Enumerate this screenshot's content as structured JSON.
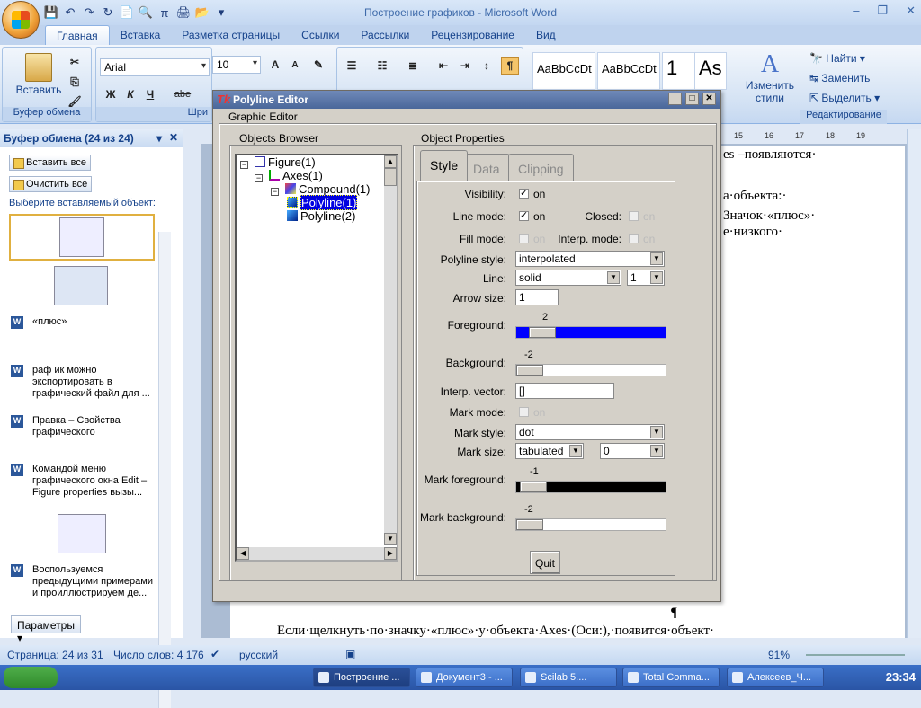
{
  "word": {
    "title": "Построение графиков - Microsoft Word",
    "qat": [
      "💾",
      "↶",
      "↷",
      "↻",
      "📄",
      "🔍",
      "π",
      "🖨",
      "📂",
      "▾"
    ],
    "controls": [
      "–",
      "❐",
      "✕"
    ],
    "tabs": [
      "Главная",
      "Вставка",
      "Разметка страницы",
      "Ссылки",
      "Рассылки",
      "Рецензирование",
      "Вид"
    ],
    "ribbon": {
      "paste_label": "Вставить",
      "clipboard_group": "Буфер обмена",
      "font_group_partial": "Шри",
      "font_name": "Arial",
      "font_size": "10",
      "bold": "Ж",
      "italic": "К",
      "underline": "Ч",
      "strike": "abe",
      "styles": [
        "AaBbCcDt",
        "AaBbCcDt",
        "1",
        "As"
      ],
      "change_styles": "Изменить стили",
      "find": "Найти",
      "replace": "Заменить",
      "select": "Выделить",
      "editing_group": "Редактирование"
    }
  },
  "clipboard": {
    "header": "Буфер обмена (24 из 24)",
    "paste_all": "Вставить все",
    "clear_all": "Очистить все",
    "prompt": "Выберите вставляемый объект:",
    "items": [
      "«плюс»",
      "раф ик можно экспортировать в графический файл для ...",
      "Правка – Свойства графического",
      "Командой меню графического окна Edit – Figure properties вызы...",
      "Воспользуемся предыдущими примерами и проиллюстрируем де..."
    ],
    "params": "Параметры"
  },
  "document": {
    "ruler_marks": [
      "15",
      "16",
      "17",
      "18",
      "19"
    ],
    "line1": "es –появляются·",
    "line2": "а·объекта:·",
    "line3": "Значок·«плюс»·",
    "line4": "е·низкого·",
    "bottom_line": "Если·щелкнуть·по·значку·«плюс»·у·объекта·Axes·(Оси:),·появится·объект·",
    "para_mark": "¶"
  },
  "status": {
    "page": "Страница: 24 из 31",
    "words": "Число слов: 4 176",
    "lang": "русский",
    "zoom": "91%"
  },
  "taskbar": {
    "tasks": [
      "Построение ...",
      "Документ3 - ...",
      "Scilab 5....",
      "Total Comma...",
      "Алексеев_Ч..."
    ],
    "clock": "23:34"
  },
  "editor": {
    "title": "Polyline Editor",
    "tk_icon": "Tk",
    "graphic_editor": "Graphic Editor",
    "objects_browser": "Objects Browser",
    "object_properties": "Object Properties",
    "tree": [
      "Figure(1)",
      "Axes(1)",
      "Compound(1)",
      "Polyline(1)",
      "Polyline(2)"
    ],
    "tabs": [
      "Style",
      "Data",
      "Clipping"
    ],
    "visibility_label": "Visibility:",
    "visibility_val": "on",
    "line_mode_label": "Line mode:",
    "line_mode_val": "on",
    "closed_label": "Closed:",
    "closed_val": "on",
    "fill_mode_label": "Fill mode:",
    "fill_mode_val": "on",
    "interp_mode_label": "Interp. mode:",
    "interp_mode_val": "on",
    "polyline_style_label": "Polyline style:",
    "polyline_style": "interpolated",
    "line_label": "Line:",
    "line_style": "solid",
    "line_width": "1",
    "arrow_size_label": "Arrow size:",
    "arrow_size": "1",
    "foreground_label": "Foreground:",
    "foreground_val": "2",
    "background_label": "Background:",
    "background_val": "-2",
    "interp_vector_label": "Interp. vector:",
    "interp_vector": "[]",
    "mark_mode_label": "Mark mode:",
    "mark_mode_val": "on",
    "mark_style_label": "Mark style:",
    "mark_style": "dot",
    "mark_size_label": "Mark size:",
    "mark_size_unit": "tabulated",
    "mark_size": "0",
    "mark_fg_label": "Mark foreground:",
    "mark_fg_val": "-1",
    "mark_bg_label": "Mark background:",
    "mark_bg_val": "-2",
    "quit": "Quit",
    "colors": {
      "foreground": "#0000ff",
      "mark_foreground": "#000000",
      "background": "#ffffff"
    }
  }
}
